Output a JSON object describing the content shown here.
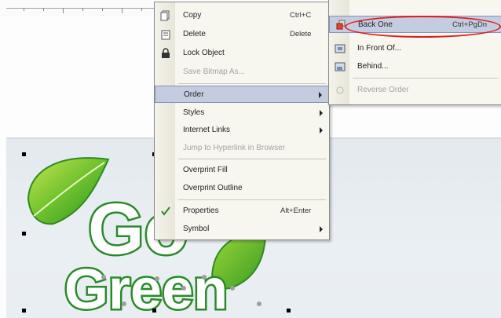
{
  "context_menu": {
    "copy": {
      "label": "Copy",
      "shortcut": "Ctrl+C"
    },
    "delete": {
      "label": "Delete",
      "shortcut": "Delete"
    },
    "lock": {
      "label": "Lock Object"
    },
    "save_bitmap": {
      "label": "Save Bitmap As..."
    },
    "order": {
      "label": "Order"
    },
    "styles": {
      "label": "Styles"
    },
    "internet_links": {
      "label": "Internet Links"
    },
    "jump_hyperlink": {
      "label": "Jump to Hyperlink in Browser"
    },
    "overprint_fill": {
      "label": "Overprint Fill"
    },
    "overprint_outline": {
      "label": "Overprint Outline"
    },
    "properties": {
      "label": "Properties",
      "shortcut": "Alt+Enter"
    },
    "symbol": {
      "label": "Symbol"
    }
  },
  "order_submenu": {
    "back_one": {
      "label": "Back One",
      "shortcut": "Ctrl+PgDn"
    },
    "in_front_of": {
      "label": "In Front Of..."
    },
    "behind": {
      "label": "Behind..."
    },
    "reverse_order": {
      "label": "Reverse Order"
    }
  },
  "canvas": {
    "logo_line1": "Go",
    "logo_line2": "Green"
  },
  "colors": {
    "menu_bg": "#f7f6ef",
    "highlight": "#c4cde0",
    "highlight_oval": "#e51919",
    "leaf_green": "#5fb52a",
    "text_outline": "#2a8a2a"
  }
}
